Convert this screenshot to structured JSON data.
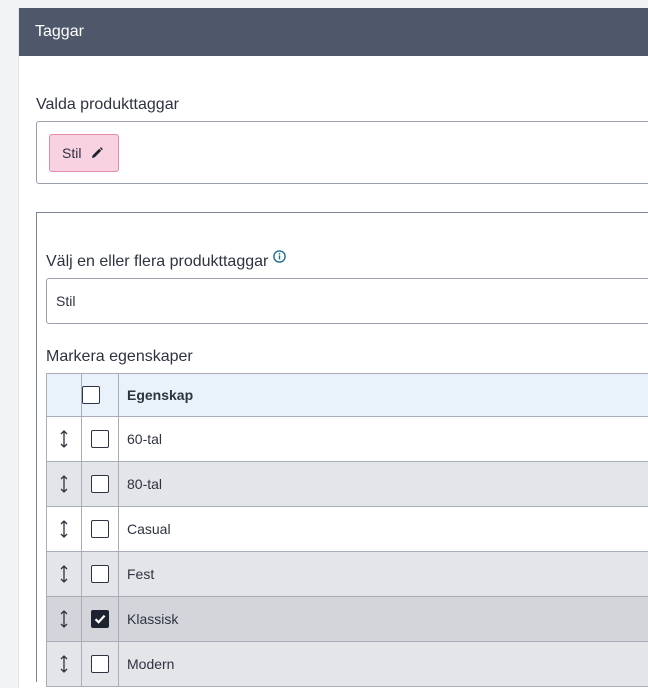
{
  "panel": {
    "title": "Taggar"
  },
  "selected": {
    "label": "Valda produkttaggar",
    "chips": [
      {
        "label": "Stil",
        "icon": "pencil-icon"
      }
    ]
  },
  "chooser": {
    "label": "Välj en eller flera produkttaggar",
    "info_icon": "info-icon",
    "value": "Stil"
  },
  "properties": {
    "label": "Markera egenskaper",
    "column_header": "Egenskap",
    "rows": [
      {
        "name": "60-tal",
        "checked": false
      },
      {
        "name": "80-tal",
        "checked": false
      },
      {
        "name": "Casual",
        "checked": false
      },
      {
        "name": "Fest",
        "checked": false
      },
      {
        "name": "Klassisk",
        "checked": true
      },
      {
        "name": "Modern",
        "checked": false
      }
    ]
  },
  "colors": {
    "header_bg": "#4f586b",
    "chip_bg": "#f9d2e2",
    "chip_border": "#e48bb0",
    "table_header_bg": "#e9f2fb",
    "info_icon": "#1f6e8c"
  }
}
